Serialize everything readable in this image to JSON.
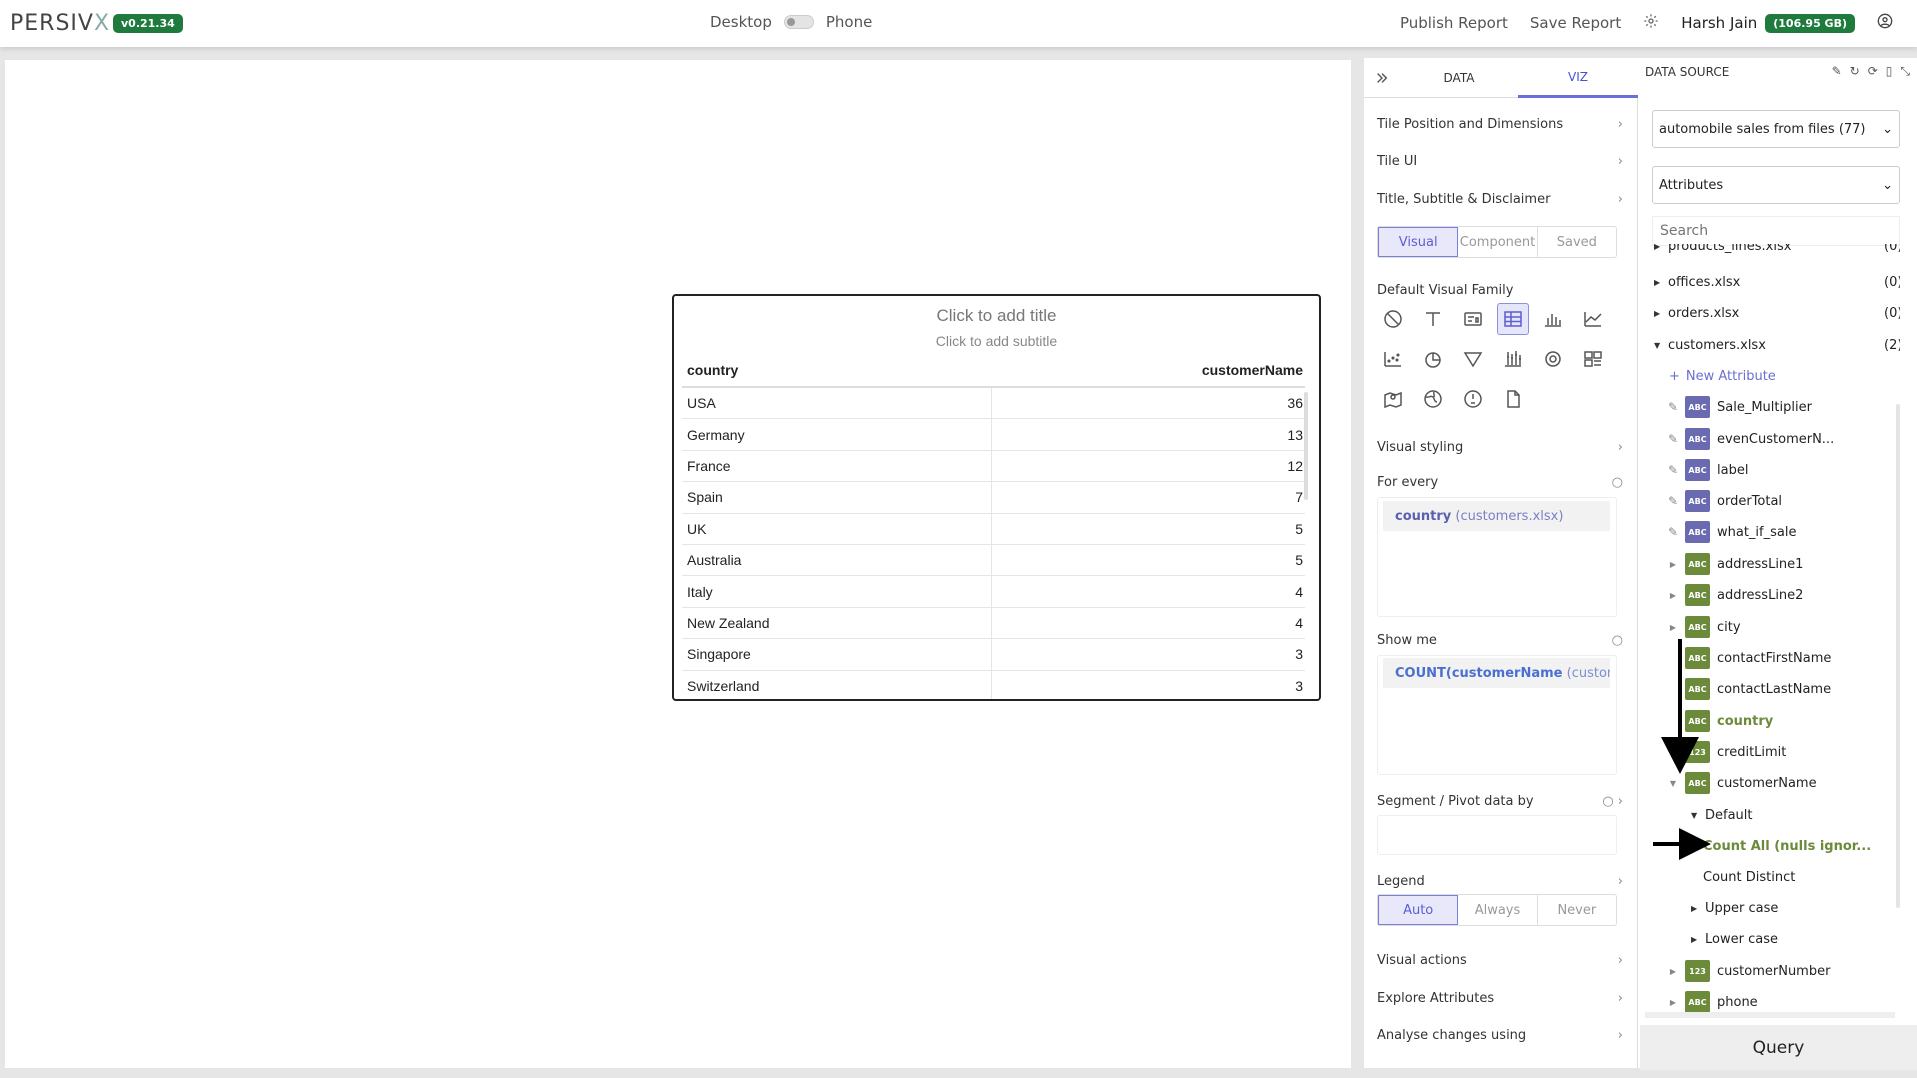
{
  "app": {
    "logo_main": "PERSIV",
    "logo_x": "X",
    "version": "v0.21.34"
  },
  "header": {
    "desktop_label": "Desktop",
    "phone_label": "Phone",
    "publish_label": "Publish Report",
    "save_label": "Save Report",
    "user_name": "Harsh Jain",
    "storage_badge": "(106.95 GB)"
  },
  "tile": {
    "title_placeholder": "Click to add title",
    "subtitle_placeholder": "Click to add subtitle",
    "columns": [
      "country",
      "customerName"
    ],
    "rows": [
      [
        "USA",
        "36"
      ],
      [
        "Germany",
        "13"
      ],
      [
        "France",
        "12"
      ],
      [
        "Spain",
        "7"
      ],
      [
        "UK",
        "5"
      ],
      [
        "Australia",
        "5"
      ],
      [
        "Italy",
        "4"
      ],
      [
        "New Zealand",
        "4"
      ],
      [
        "Singapore",
        "3"
      ],
      [
        "Switzerland",
        "3"
      ]
    ]
  },
  "panel": {
    "tabs": {
      "data": "DATA",
      "viz": "VIZ"
    },
    "sections": {
      "tile_position": "Tile Position and Dimensions",
      "tile_ui": "Tile UI",
      "title_subtitle": "Title, Subtitle & Disclaimer",
      "default_family": "Default Visual Family",
      "visual_styling": "Visual styling",
      "for_every": "For every",
      "show_me": "Show me",
      "segment": "Segment / Pivot data by",
      "legend": "Legend",
      "visual_actions": "Visual actions",
      "explore_attributes": "Explore Attributes",
      "analyse_changes": "Analyse changes using"
    },
    "mode_options": [
      "Visual",
      "Component",
      "Saved"
    ],
    "legend_options": [
      "Auto",
      "Always",
      "Never"
    ],
    "for_every_chip": {
      "field": "country",
      "source": "(customers.xlsx)"
    },
    "show_me_chip": {
      "text": "COUNT(customerName",
      "source": "(custome"
    }
  },
  "datasource": {
    "header": "DATA SOURCE",
    "source_select": "automobile sales from files (77)",
    "type_select": "Attributes",
    "search_placeholder": "Search",
    "query_label": "Query",
    "files": [
      {
        "name": "products_lines.xlsx",
        "count": "(0)"
      },
      {
        "name": "offices.xlsx",
        "count": "(0)"
      },
      {
        "name": "orders.xlsx",
        "count": "(0)"
      },
      {
        "name": "customers.xlsx",
        "count": "(2)"
      }
    ],
    "new_attribute": "New Attribute",
    "attributes": [
      {
        "name": "Sale_Multiplier",
        "type": "ABC"
      },
      {
        "name": "evenCustomerN...",
        "type": "ABC"
      },
      {
        "name": "label",
        "type": "ABC"
      },
      {
        "name": "orderTotal",
        "type": "ABC"
      },
      {
        "name": "what_if_sale",
        "type": "ABC"
      },
      {
        "name": "addressLine1",
        "type": "ABC"
      },
      {
        "name": "addressLine2",
        "type": "ABC"
      },
      {
        "name": "city",
        "type": "ABC"
      },
      {
        "name": "contactFirstName",
        "type": "ABC"
      },
      {
        "name": "contactLastName",
        "type": "ABC"
      },
      {
        "name": "country",
        "type": "ABC"
      },
      {
        "name": "creditLimit",
        "type": "123"
      },
      {
        "name": "customerName",
        "type": "ABC"
      },
      {
        "name": "customerNumber",
        "type": "123"
      },
      {
        "name": "phone",
        "type": "ABC"
      }
    ],
    "sub": {
      "default": "Default",
      "count_all": "Count All (nulls ignor...",
      "count_distinct": "Count Distinct",
      "upper_case": "Upper case",
      "lower_case": "Lower case"
    }
  }
}
